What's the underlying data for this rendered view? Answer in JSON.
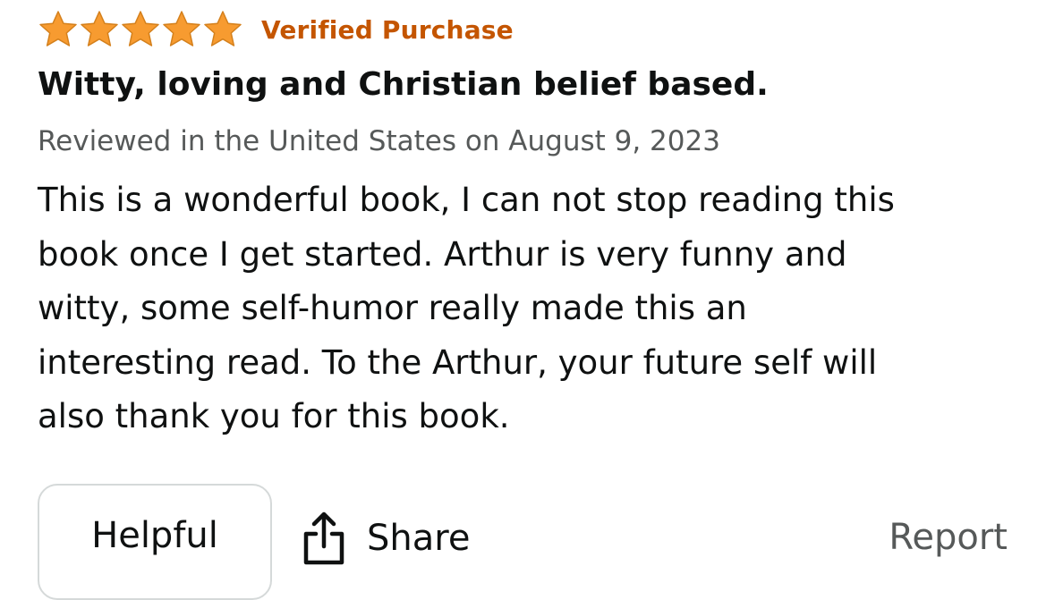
{
  "review": {
    "rating": 5,
    "rating_max": 5,
    "star_color": "#f79b30",
    "verified_label": "Verified Purchase",
    "verified_color": "#c45500",
    "title": "Witty, loving and Christian belief based.",
    "meta": "Reviewed in the United States on August 9, 2023",
    "body_lines": [
      "This is a wonderful book, I can not stop reading this",
      "book once I get started. Arthur is very funny and",
      "witty, some self-humor really made this an",
      "interesting read. To the Arthur, your future self will",
      "also thank you for this book."
    ]
  },
  "actions": {
    "helpful_label": "Helpful",
    "share_label": "Share",
    "share_icon": "share-icon",
    "report_label": "Report"
  }
}
